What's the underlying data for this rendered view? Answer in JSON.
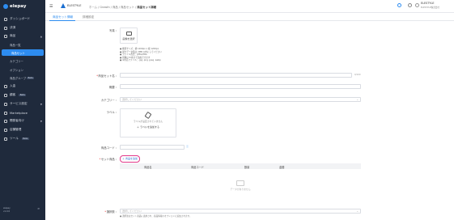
{
  "sidebar": {
    "logo": "elepay",
    "items": [
      {
        "label": "ダッシュボード",
        "badge": ""
      },
      {
        "label": "決済",
        "badge": ""
      },
      {
        "label": "商品",
        "badge": ""
      },
      {
        "label": "入金",
        "badge": ""
      },
      {
        "label": "顧客",
        "badge": "Beta"
      },
      {
        "label": "サービス設定",
        "badge": ""
      },
      {
        "label": "Marketplace",
        "badge": ""
      },
      {
        "label": "開発者向け",
        "badge": ""
      },
      {
        "label": "店舗管理",
        "badge": ""
      },
      {
        "label": "ツール",
        "badge": "Beta"
      }
    ],
    "subitems": [
      {
        "label": "商品一覧",
        "badge": ""
      },
      {
        "label": "商品セット",
        "badge": ""
      },
      {
        "label": "カテゴリー",
        "badge": ""
      },
      {
        "label": "オプション",
        "badge": ""
      },
      {
        "label": "商品グループ",
        "badge": "Beta"
      }
    ],
    "footer_line1": "elepay",
    "footer_line2": "v1.0.0"
  },
  "header": {
    "company": "ELESTYLE",
    "breadcrumb": [
      "ホーム / Growth",
      "商品",
      "商品セット",
      "商品セット詳細"
    ],
    "user_name": "ELESTYLE",
    "user_email": "ELESTYLE株式会社"
  },
  "tabs": [
    "商品セット情報",
    "詳細設定"
  ],
  "form": {
    "image_label": "写真 :",
    "image_button": "画像を選択",
    "image_notes": [
      "● 推奨サイズ：横 1200px x 縦 1200px",
      "● 最大データ量は 2MB 以内にしてください",
      "● ファイル形式：JPEG/PNG",
      "● 画像は 8 枚まで追加できます",
      "● ※対応ファイル：.jpg .png .jpeg .webp"
    ],
    "name_label": "商品セット名 :",
    "name_counter": "0/100",
    "desc_label": "概要 :",
    "category_label": "カテゴリー :",
    "category_placeholder": "選択してください",
    "label_label": "ラベル :",
    "label_empty": "ラベルが設定されていません",
    "label_add": "＋ ラベルを追加する",
    "code_label": "商品コード :",
    "set_label": "セット商品 :",
    "add_product": "＋ 商品を追加",
    "table_headers": [
      "商品名",
      "商品コード",
      "数量",
      "金額"
    ],
    "table_empty": "データがありません",
    "option_label": "選択肢 :",
    "option_placeholder": "選択してください",
    "option_note": "● 選択肢はセット商品に適用され、商品情報のオプションに追加されます。"
  }
}
